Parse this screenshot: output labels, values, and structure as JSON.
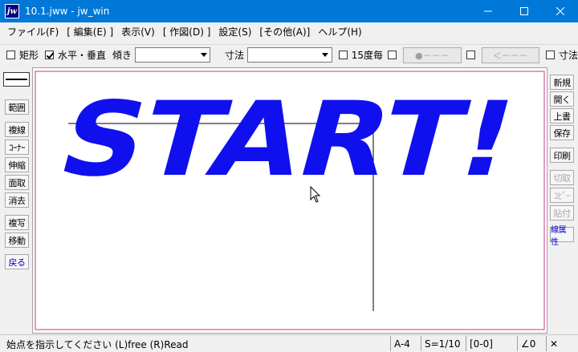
{
  "window": {
    "icon_text": "jw",
    "title": "10.1.jww - jw_win"
  },
  "menu": [
    "ファイル(F)",
    "[ 編集(E) ]",
    "表示(V)",
    "[ 作図(D) ]",
    "設定(S)",
    "[その他(A)]",
    "ヘルプ(H)"
  ],
  "toolbar": {
    "rect_label": "矩形",
    "horizvert_label": "水平・垂直",
    "tilt_label": "傾き",
    "tilt_value": "",
    "dim_label": "寸法",
    "dim_value": "",
    "deg15_label": "15度毎",
    "btn_a": "●－－－",
    "btn_b": "＜－－－",
    "last_label": "寸法"
  },
  "left_tools": [
    "範囲",
    "複線",
    "ｺｰﾅｰ",
    "伸縮",
    "面取",
    "消去",
    "複写",
    "移動",
    "戻る"
  ],
  "right_tools": [
    "新規",
    "開く",
    "上書",
    "保存",
    "印刷",
    "切取",
    "ｺﾋﾟｰ",
    "貼付",
    "線属性"
  ],
  "canvas": {
    "big_text": "START!",
    "text_color": "#1010ee",
    "frame_color": "#d0308a"
  },
  "status": {
    "message": "始点を指示してください (L)free (R)Read",
    "paper": "A-4",
    "scale": "S=1/10",
    "layer": "[0-0]",
    "angle": "∠0",
    "close_glyph": "✕"
  }
}
